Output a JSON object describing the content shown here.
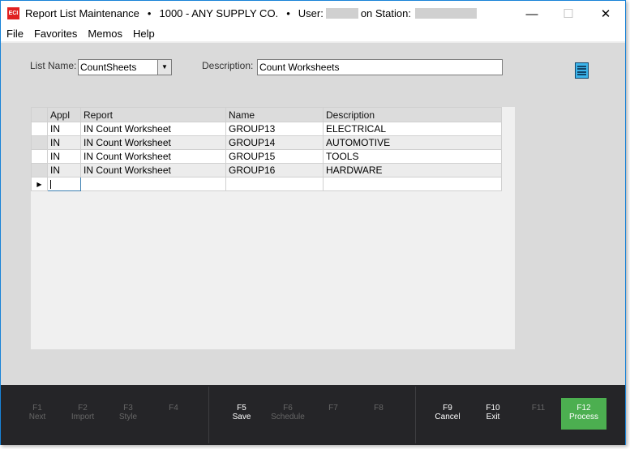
{
  "window": {
    "title": "Report List Maintenance",
    "company": "1000 - ANY SUPPLY CO.",
    "user_label": "User:",
    "station_label": "on Station:",
    "logo": "ECI",
    "separator": "•"
  },
  "menu": [
    "File",
    "Favorites",
    "Memos",
    "Help"
  ],
  "form": {
    "list_name_label": "List Name:",
    "list_name_value": "CountSheets",
    "description_label": "Description:",
    "description_value": "Count Worksheets"
  },
  "grid": {
    "columns": [
      "Appl",
      "Report",
      "Name",
      "Description"
    ],
    "rows": [
      [
        "IN",
        "IN Count Worksheet",
        "GROUP13",
        "ELECTRICAL"
      ],
      [
        "IN",
        "IN Count Worksheet",
        "GROUP14",
        "AUTOMOTIVE"
      ],
      [
        "IN",
        "IN Count Worksheet",
        "GROUP15",
        "TOOLS"
      ],
      [
        "IN",
        "IN Count Worksheet",
        "GROUP16",
        "HARDWARE"
      ]
    ]
  },
  "fkeys": [
    {
      "key": "F1",
      "label": "Next",
      "enabled": false
    },
    {
      "key": "F2",
      "label": "Import",
      "enabled": false
    },
    {
      "key": "F3",
      "label": "Style",
      "enabled": false
    },
    {
      "key": "F4",
      "label": "",
      "enabled": false
    },
    {
      "key": "F5",
      "label": "Save",
      "enabled": true
    },
    {
      "key": "F6",
      "label": "Schedule",
      "enabled": false
    },
    {
      "key": "F7",
      "label": "",
      "enabled": false
    },
    {
      "key": "F8",
      "label": "",
      "enabled": false
    },
    {
      "key": "F9",
      "label": "Cancel",
      "enabled": true
    },
    {
      "key": "F10",
      "label": "Exit",
      "enabled": true
    },
    {
      "key": "F11",
      "label": "",
      "enabled": false
    },
    {
      "key": "F12",
      "label": "Process",
      "enabled": true
    }
  ],
  "colors": {
    "accent": "#4caf50",
    "footer": "#252528",
    "body": "#dadada",
    "logo": "#e02020",
    "list_icon": "#3cb4ea"
  }
}
